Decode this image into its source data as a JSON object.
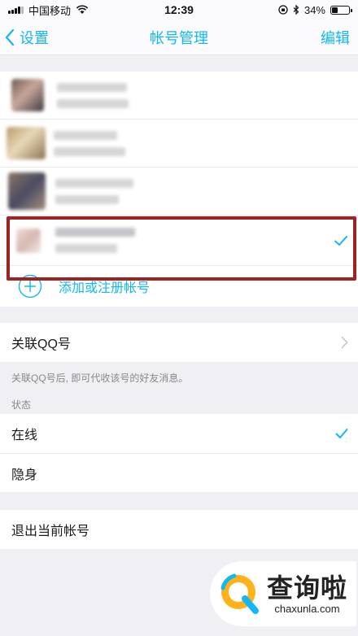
{
  "status_bar": {
    "carrier": "中国移动",
    "time": "12:39",
    "battery": "34%",
    "battery_level": 0.34
  },
  "nav": {
    "back_label": "设置",
    "title": "帐号管理",
    "edit_label": "编辑"
  },
  "accounts": {
    "add_label": "添加或注册帐号"
  },
  "linked_qq": {
    "label": "关联QQ号",
    "hint": "关联QQ号后, 即可代收该号的好友消息。"
  },
  "status_section": {
    "header": "状态",
    "options": [
      "在线",
      "隐身"
    ],
    "selected": "在线"
  },
  "logout": {
    "label": "退出当前帐号"
  },
  "watermark": {
    "brand": "查询啦",
    "domain": "chaxunla.com"
  },
  "colors": {
    "accent": "#12b7f5",
    "highlight_border": "#9e2421",
    "background": "#f0f0f4"
  }
}
